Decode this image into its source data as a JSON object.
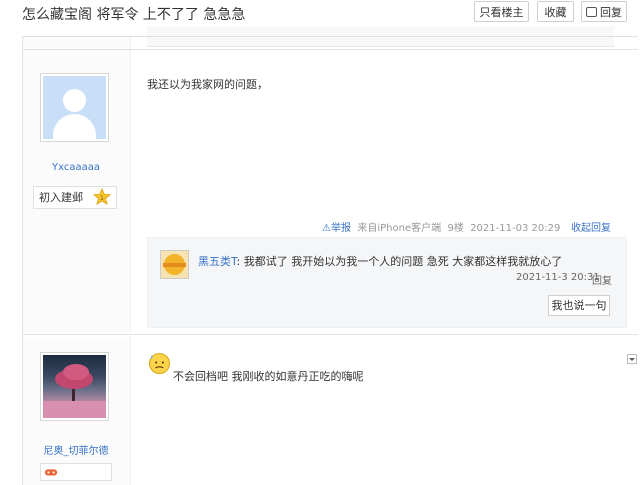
{
  "header": {
    "thread_title": "怎么藏宝阁 将军令 上不了了 急急急",
    "buttons": {
      "only_host": "只看楼主",
      "favorite": "收藏",
      "reply": "回复"
    }
  },
  "posts": [
    {
      "username": "Yxcaaaaa",
      "rank": "初入建邺",
      "content": "我还以为我家网的问题，",
      "report": "举报",
      "source": "来自iPhone客户端",
      "floor": "9楼",
      "time": "2021-11-03 20:29",
      "collapse": "收起回复",
      "replies": [
        {
          "user": "黑五类T",
          "text": ": 我都试了 我开始以为我一个人的问题 急死 大家都这样我就放心了",
          "time": "2021-11-3 20:31",
          "reply_label": "回复"
        }
      ],
      "say_button": "我也说一句"
    },
    {
      "username": "尼奥_切菲尔德",
      "content": "不会回档吧 我刚收的如意丹正吃的嗨呢"
    }
  ],
  "colors": {
    "link": "#3873c9",
    "meta": "#999999",
    "reply_bg": "#f5f6f8"
  }
}
